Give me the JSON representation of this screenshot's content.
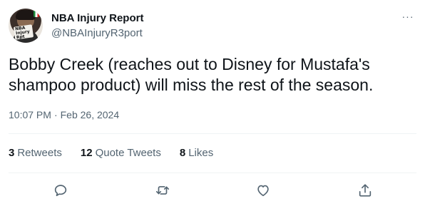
{
  "tweet": {
    "author": {
      "display_name": "NBA Injury Report",
      "handle": "@NBAInjuryR3port",
      "avatar_icon": "avatar-image"
    },
    "text": "Bobby Creek (reaches out to Disney for Mustafa's shampoo product) will miss the rest of the season.",
    "meta": {
      "time": "10:07 PM",
      "separator": "·",
      "date": "Feb 26, 2024"
    },
    "stats": {
      "retweets": {
        "count": "3",
        "label": "Retweets"
      },
      "quote_tweets": {
        "count": "12",
        "label": "Quote Tweets"
      },
      "likes": {
        "count": "8",
        "label": "Likes"
      }
    },
    "more_label": "···",
    "actions": [
      "reply-icon",
      "retweet-icon",
      "like-icon",
      "share-icon"
    ]
  },
  "colors": {
    "text_primary": "#0f1419",
    "text_secondary": "#536471",
    "divider": "#eff3f4",
    "background": "#ffffff"
  }
}
